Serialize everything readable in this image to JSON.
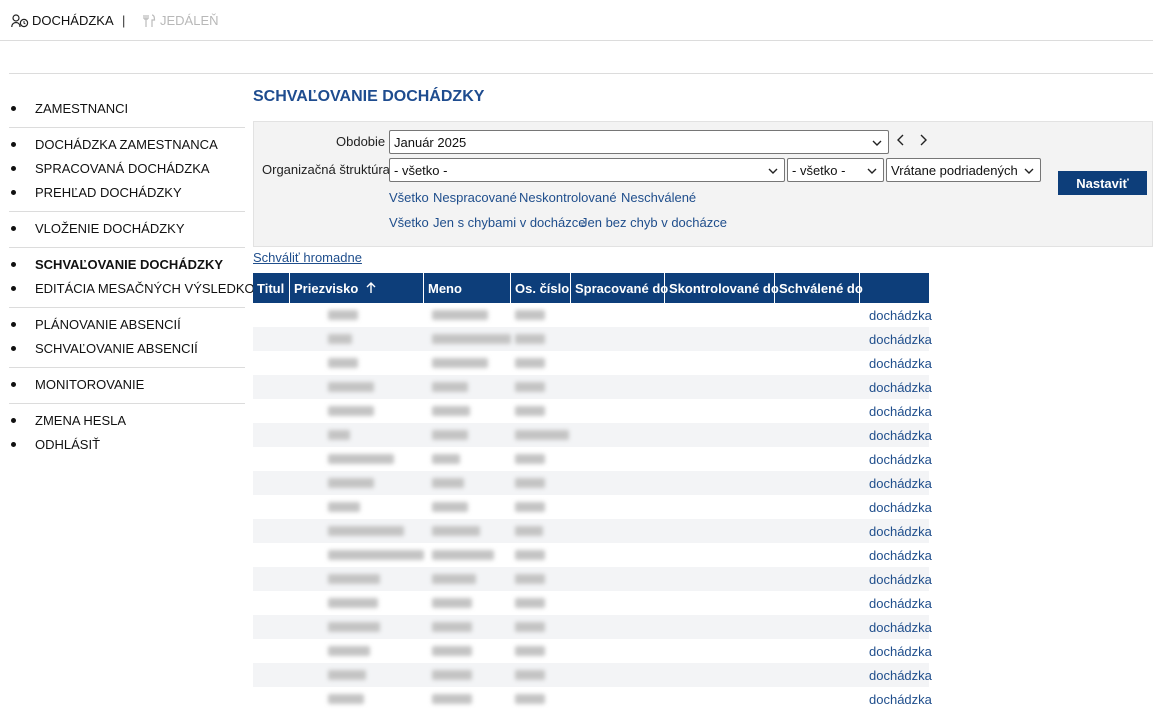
{
  "apps": {
    "attendance": "DOCHÁDZKA",
    "separator": "|",
    "canteen": "JEDÁLEŇ"
  },
  "sidebar": {
    "groups": [
      [
        "ZAMESTNANCI"
      ],
      [
        "DOCHÁDZKA ZAMESTNANCA",
        "SPRACOVANÁ DOCHÁDZKA",
        "PREHĽAD DOCHÁDZKY"
      ],
      [
        "VLOŽENIE DOCHÁDZKY"
      ],
      [
        "SCHVAĽOVANIE DOCHÁDZKY",
        "EDITÁCIA MESAČNÝCH VÝSLEDKOV"
      ],
      [
        "PLÁNOVANIE ABSENCIÍ",
        "SCHVAĽOVANIE ABSENCIÍ"
      ],
      [
        "MONITOROVANIE"
      ],
      [
        "ZMENA HESLA",
        "ODHLÁSIŤ"
      ]
    ],
    "active": "SCHVAĽOVANIE DOCHÁDZKY"
  },
  "page": {
    "title": "SCHVAĽOVANIE DOCHÁDZKY"
  },
  "filters": {
    "period_label": "Obdobie",
    "period_value": "Január 2025",
    "prev_icon": "chevron-left-icon",
    "next_icon": "chevron-right-icon",
    "org_label": "Organizačná štruktúra",
    "org_value": "- všetko -",
    "org2_value": "- všetko -",
    "sub_value": "Vrátane podriadených",
    "set_button": "Nastaviť",
    "status_links": [
      "Všetko",
      "Nespracované",
      "Neskontrolované",
      "Neschválené"
    ],
    "error_links": [
      "Všetko",
      "Jen s chybami v docházce",
      "Jen bez chyb v docházce"
    ]
  },
  "bulk_approve": "Schváliť hromadne",
  "table": {
    "headers": [
      "Titul",
      "Priezvisko",
      "Meno",
      "Os. číslo",
      "Spracované do",
      "Skontrolované do",
      "Schválené do",
      ""
    ],
    "sort_icon": "arrow-up-icon",
    "action_label": "dochádzka",
    "rows": 17
  },
  "colors": {
    "accent": "#0d3e7a",
    "link": "#1f4e8c",
    "title": "#1e4c8f"
  }
}
